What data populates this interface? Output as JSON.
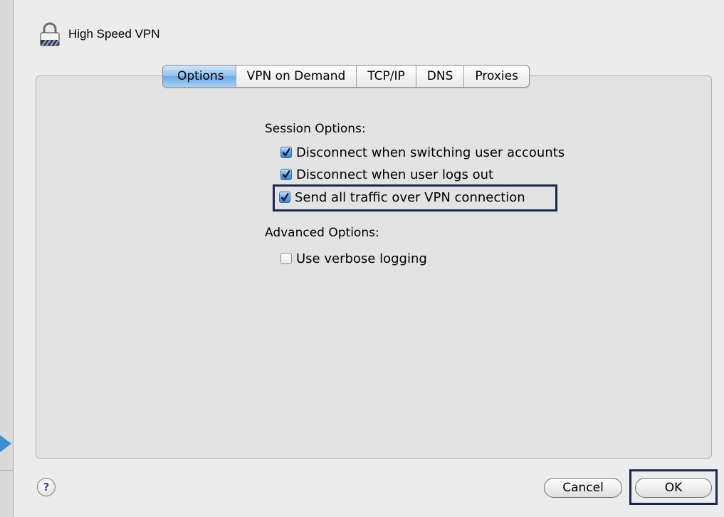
{
  "window": {
    "title": "High Speed VPN"
  },
  "tabs": [
    {
      "label": "Options",
      "active": true
    },
    {
      "label": "VPN on Demand",
      "active": false
    },
    {
      "label": "TCP/IP",
      "active": false
    },
    {
      "label": "DNS",
      "active": false
    },
    {
      "label": "Proxies",
      "active": false
    }
  ],
  "session": {
    "label": "Session Options:",
    "options": [
      {
        "label": "Disconnect when switching user accounts",
        "checked": true
      },
      {
        "label": "Disconnect when user logs out",
        "checked": true
      },
      {
        "label": "Send all traffic over VPN connection",
        "checked": true
      }
    ]
  },
  "advanced": {
    "label": "Advanced Options:",
    "options": [
      {
        "label": "Use verbose logging",
        "checked": false
      }
    ]
  },
  "buttons": {
    "help": "?",
    "cancel": "Cancel",
    "ok": "OK"
  },
  "icons": {
    "title_icon": "lock-icon",
    "help_icon": "question-icon"
  },
  "colors": {
    "highlight": "#1c2650",
    "accent": "#5d9fe0"
  }
}
